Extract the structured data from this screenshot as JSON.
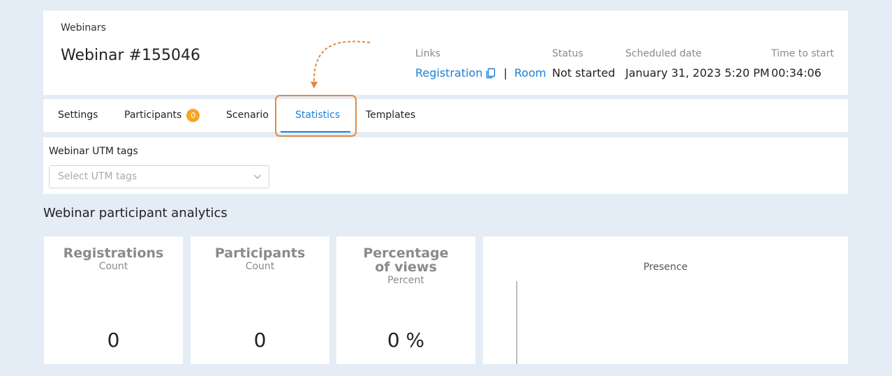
{
  "header": {
    "breadcrumb": "Webinars",
    "title": "Webinar #155046",
    "links_label": "Links",
    "registration_link": "Registration",
    "separator": "|",
    "room_link": "Room",
    "status_label": "Status",
    "status_value": "Not started",
    "scheduled_label": "Scheduled date",
    "scheduled_value": "January 31, 2023 5:20 PM",
    "time_label": "Time to start",
    "time_value": "00:34:06"
  },
  "tabs": [
    {
      "label": "Settings"
    },
    {
      "label": "Participants",
      "badge": "0"
    },
    {
      "label": "Scenario"
    },
    {
      "label": "Statistics",
      "active": true
    },
    {
      "label": "Templates"
    }
  ],
  "utm": {
    "label": "Webinar UTM tags",
    "placeholder": "Select UTM tags"
  },
  "analytics": {
    "title": "Webinar participant analytics",
    "cards": [
      {
        "title": "Registrations",
        "subtitle": "Count",
        "value": "0"
      },
      {
        "title": "Participants",
        "subtitle": "Count",
        "value": "0"
      },
      {
        "title": "Percentage of views",
        "subtitle": "Percent",
        "value": "0 %"
      }
    ],
    "presence_title": "Presence"
  },
  "colors": {
    "accent": "#1a7fd4",
    "badge": "#f5a623",
    "highlight": "#e08a3c",
    "background": "#e4ecf6"
  },
  "icons": {
    "copy": "copy-icon",
    "chevron": "chevron-down-icon"
  }
}
